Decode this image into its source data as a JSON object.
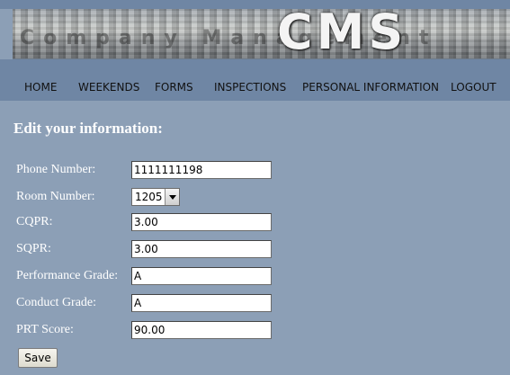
{
  "banner": {
    "logo_text": "CMS",
    "ghost_text": "Company Management"
  },
  "nav": {
    "items": [
      "HOME",
      "WEEKENDS",
      "FORMS",
      "INSPECTIONS",
      "PERSONAL INFORMATION",
      "LOGOUT"
    ]
  },
  "form": {
    "heading": "Edit your information:",
    "phone": {
      "label": "Phone Number:",
      "value": "1111111198"
    },
    "room": {
      "label": "Room Number:",
      "value": "1205"
    },
    "cqpr": {
      "label": "CQPR:",
      "value": "3.00"
    },
    "sqpr": {
      "label": "SQPR:",
      "value": "3.00"
    },
    "performance": {
      "label": "Performance Grade:",
      "value": "A"
    },
    "conduct": {
      "label": "Conduct Grade:",
      "value": "A"
    },
    "prt": {
      "label": "PRT Score:",
      "value": "90.00"
    },
    "save_label": "Save"
  },
  "colors": {
    "background": "#8c9fb6",
    "nav_bar": "#6f86a4",
    "label_text": "#ffffff"
  }
}
